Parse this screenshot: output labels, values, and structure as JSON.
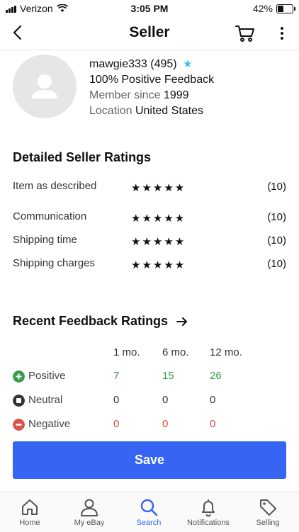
{
  "status_bar": {
    "carrier": "Verizon",
    "time": "3:05 PM",
    "battery": "42%",
    "battery_level": 0.42
  },
  "nav": {
    "title": "Seller"
  },
  "seller": {
    "username": "mawgie333",
    "score": "(495)",
    "positive_feedback": "100% Positive Feedback",
    "member_since_label": "Member since",
    "member_since_value": "1999",
    "location_label": "Location",
    "location_value": "United States"
  },
  "detailed_ratings": {
    "title": "Detailed Seller Ratings",
    "rows": [
      {
        "label": "Item as described",
        "stars": "★★★★★",
        "count": "(10)"
      },
      {
        "label": "Communication",
        "stars": "★★★★★",
        "count": "(10)"
      },
      {
        "label": "Shipping time",
        "stars": "★★★★★",
        "count": "(10)"
      },
      {
        "label": "Shipping charges",
        "stars": "★★★★★",
        "count": "(10)"
      }
    ]
  },
  "recent_feedback": {
    "title": "Recent Feedback Ratings",
    "columns": [
      "1 mo.",
      "6 mo.",
      "12 mo."
    ],
    "rows": [
      {
        "label": "Positive",
        "values": [
          "7",
          "15",
          "26"
        ]
      },
      {
        "label": "Neutral",
        "values": [
          "0",
          "0",
          "0"
        ]
      },
      {
        "label": "Negative",
        "values": [
          "0",
          "0",
          "0"
        ]
      }
    ]
  },
  "save_button": {
    "label": "Save"
  },
  "tabbar": {
    "tabs": [
      {
        "label": "Home",
        "icon": "home-icon"
      },
      {
        "label": "My eBay",
        "icon": "person-icon"
      },
      {
        "label": "Search",
        "icon": "search-icon"
      },
      {
        "label": "Notifications",
        "icon": "bell-icon"
      },
      {
        "label": "Selling",
        "icon": "tag-icon"
      }
    ],
    "active": "Search"
  },
  "colors": {
    "accent": "#3665f3",
    "positive": "#3a9b4c",
    "negative": "#e0453a",
    "star_badge": "#3cc1e8"
  }
}
